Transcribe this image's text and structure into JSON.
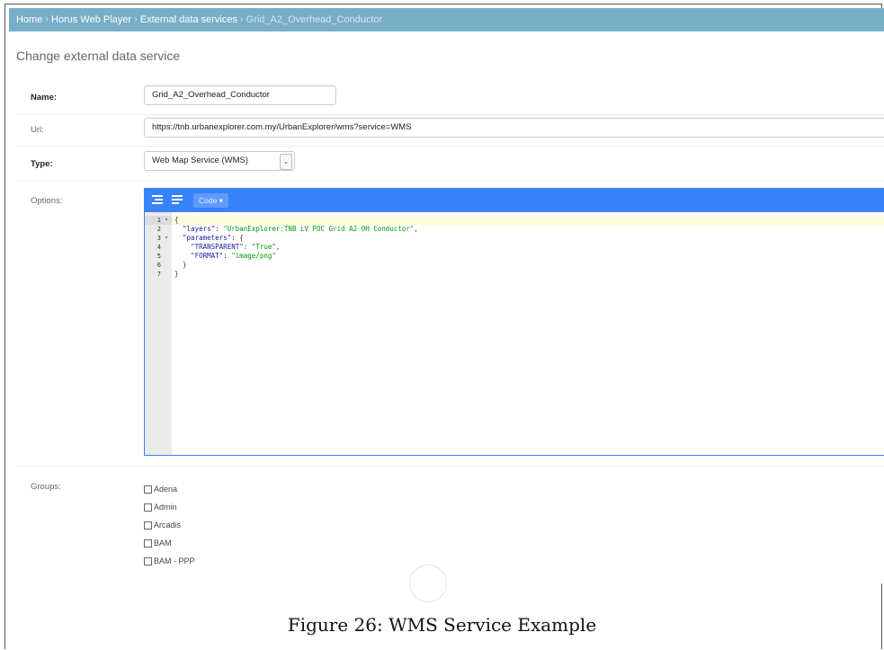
{
  "breadcrumb": {
    "home": "Home",
    "app": "Horus Web Player",
    "section": "External data services",
    "current": "Grid_A2_Overhead_Conductor",
    "separator": "›"
  },
  "page_title": "Change external data service",
  "form": {
    "name_label": "Name:",
    "name_value": "Grid_A2_Overhead_Conductor",
    "url_label": "Url:",
    "url_value": "https://tnb.urbanexplorer.com.my/UrbanExplorer/wms?service=WMS",
    "type_label": "Type:",
    "type_value": "Web Map Service (WMS)",
    "options_label": "Options:",
    "groups_label": "Groups:"
  },
  "editor": {
    "mode_button": "Code ▾",
    "toolbar_icons": [
      "format-icon",
      "compact-icon"
    ],
    "lines": [
      {
        "num": "1",
        "fold": "▾",
        "text": "{"
      },
      {
        "num": "2",
        "fold": "",
        "text": "  \"layers\": \"UrbanExplorer:TNB LV POC Grid A2 OH Conductor\","
      },
      {
        "num": "3",
        "fold": "▾",
        "text": "  \"parameters\": {"
      },
      {
        "num": "4",
        "fold": "",
        "text": "    \"TRANSPARENT\": \"True\","
      },
      {
        "num": "5",
        "fold": "",
        "text": "    \"FORMAT\": \"image/png\""
      },
      {
        "num": "6",
        "fold": "",
        "text": "  }"
      },
      {
        "num": "7",
        "fold": "",
        "text": "}"
      }
    ]
  },
  "groups": [
    "Adena",
    "Admin",
    "Arcadis",
    "BAM",
    "BAM - PPP"
  ],
  "caption": "Figure 26: WMS Service Example",
  "colors": {
    "breadcrumb_bg": "#79aec8",
    "editor_accent": "#3883fa",
    "json_key": "#1a1aa6",
    "json_string": "#009900"
  }
}
